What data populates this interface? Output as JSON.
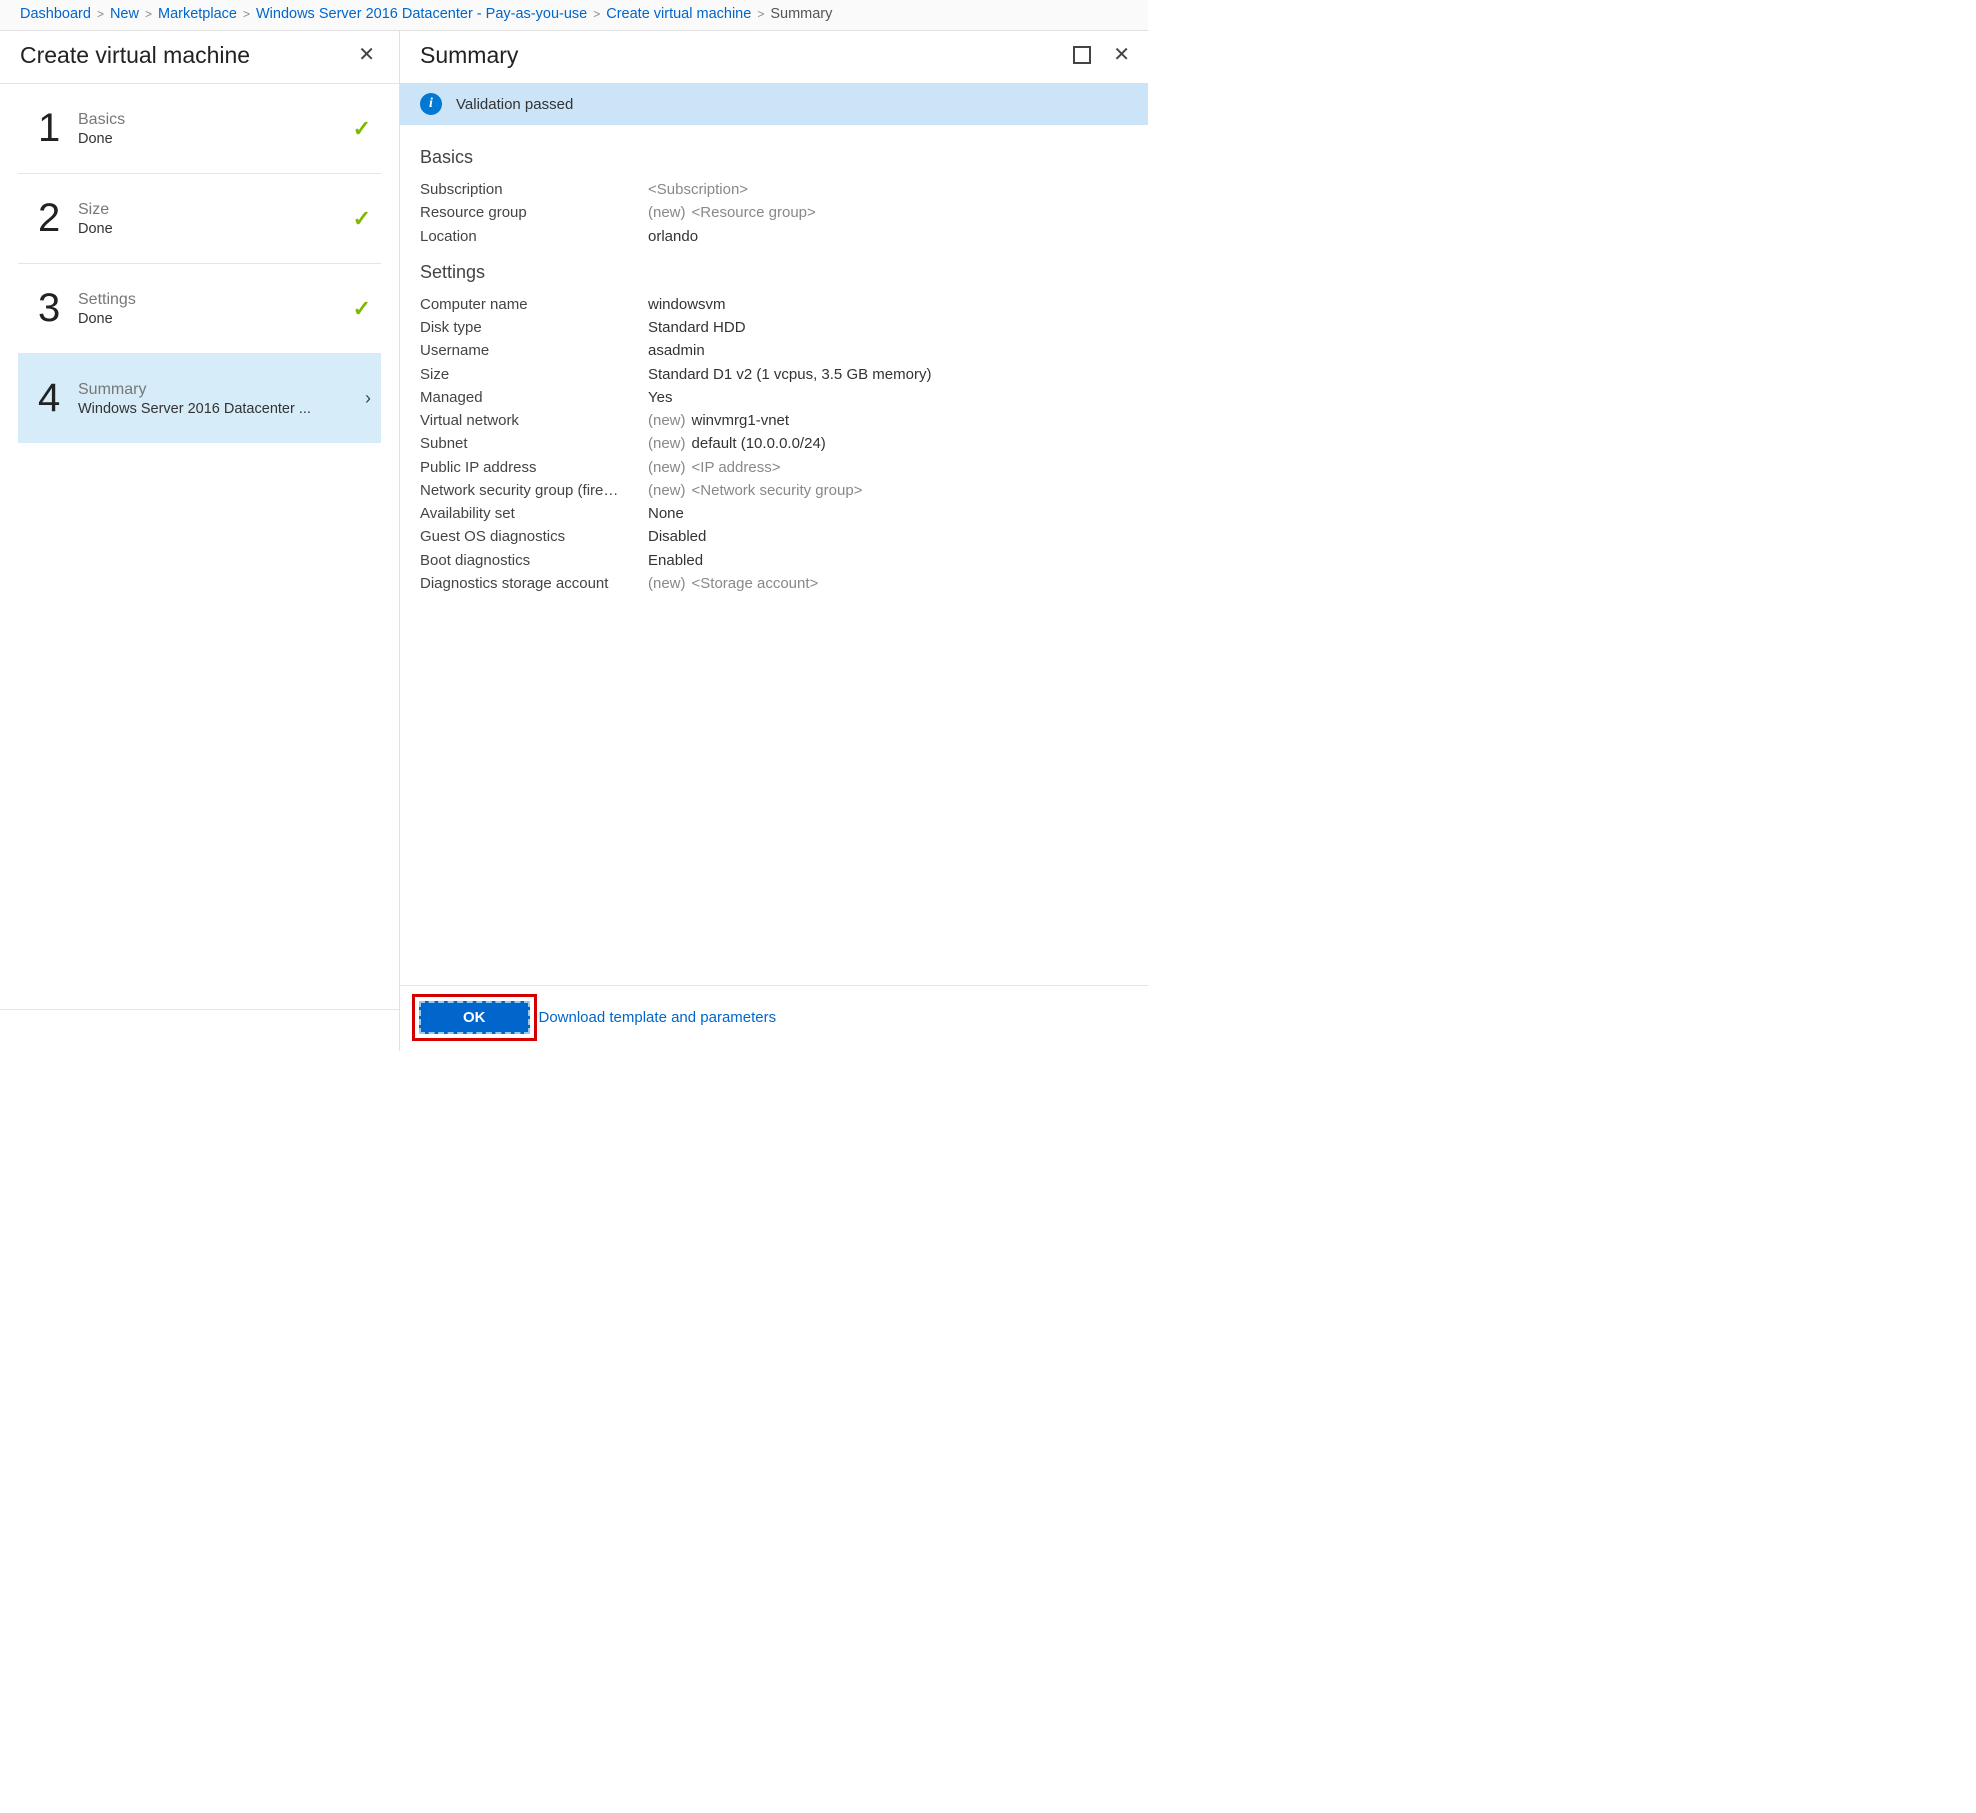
{
  "breadcrumb": [
    {
      "label": "Dashboard",
      "link": true
    },
    {
      "label": "New",
      "link": true
    },
    {
      "label": "Marketplace",
      "link": true
    },
    {
      "label": "Windows Server 2016 Datacenter - Pay-as-you-use",
      "link": true
    },
    {
      "label": "Create virtual machine",
      "link": true
    },
    {
      "label": "Summary",
      "link": false
    }
  ],
  "leftPanel": {
    "title": "Create virtual machine",
    "steps": [
      {
        "num": "1",
        "label": "Basics",
        "sub": "Done",
        "status": "done"
      },
      {
        "num": "2",
        "label": "Size",
        "sub": "Done",
        "status": "done"
      },
      {
        "num": "3",
        "label": "Settings",
        "sub": "Done",
        "status": "done"
      },
      {
        "num": "4",
        "label": "Summary",
        "sub": "Windows Server 2016 Datacenter ...",
        "status": "active"
      }
    ]
  },
  "rightPanel": {
    "title": "Summary",
    "validation": "Validation passed",
    "sections": [
      {
        "title": "Basics",
        "rows": [
          {
            "label": "Subscription",
            "value": "<Subscription>",
            "placeholder": true
          },
          {
            "label": "Resource group",
            "newPrefix": true,
            "value": "<Resource group>",
            "placeholder": true
          },
          {
            "label": "Location",
            "value": "orlando"
          }
        ]
      },
      {
        "title": "Settings",
        "rows": [
          {
            "label": "Computer name",
            "value": "windowsvm"
          },
          {
            "label": "Disk type",
            "value": "Standard HDD"
          },
          {
            "label": "Username",
            "value": "asadmin"
          },
          {
            "label": "Size",
            "value": "Standard D1 v2 (1 vcpus, 3.5 GB memory)"
          },
          {
            "label": "Managed",
            "value": "Yes"
          },
          {
            "label": "Virtual network",
            "newPrefix": true,
            "value": "winvmrg1-vnet"
          },
          {
            "label": "Subnet",
            "newPrefix": true,
            "value": "default (10.0.0.0/24)"
          },
          {
            "label": "Public IP address",
            "newPrefix": true,
            "value": "<IP address>",
            "placeholder": true
          },
          {
            "label": "Network security group (fire…",
            "newPrefix": true,
            "value": "<Network security group>",
            "placeholder": true
          },
          {
            "label": "Availability set",
            "value": "None"
          },
          {
            "label": "Guest OS diagnostics",
            "value": "Disabled"
          },
          {
            "label": "Boot diagnostics",
            "value": "Enabled"
          },
          {
            "label": "Diagnostics storage account",
            "newPrefix": true,
            "value": "<Storage account>",
            "placeholder": true
          }
        ]
      }
    ],
    "newPrefixText": "(new)",
    "okButton": "OK",
    "downloadLink": "Download template and parameters"
  }
}
